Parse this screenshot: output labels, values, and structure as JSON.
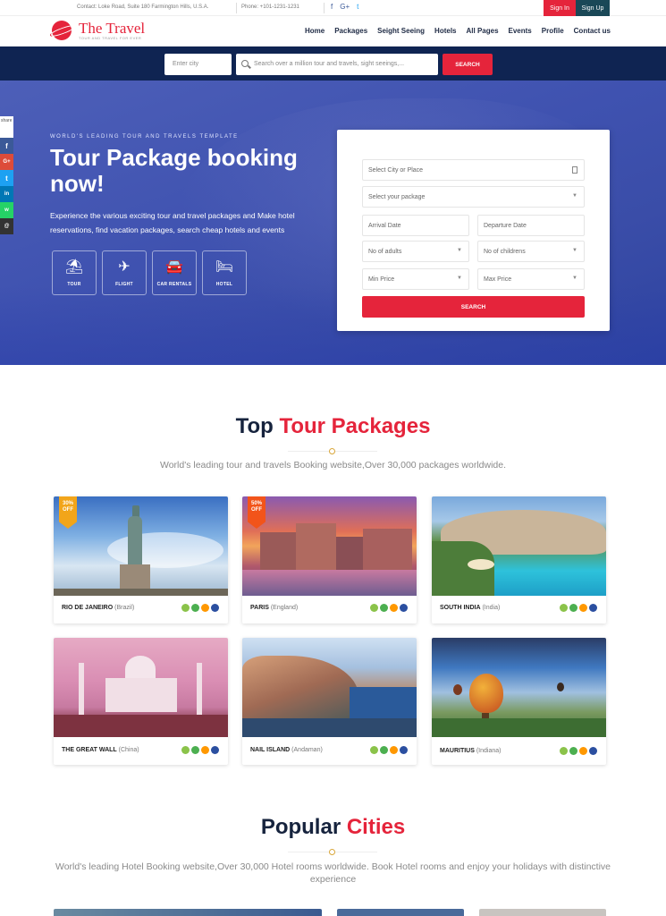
{
  "topbar": {
    "contact": "Contact: Loke Road, Suite 180 Farmington Hills, U.S.A.",
    "phone": "Phone: +101-1231-1231",
    "social": [
      "f",
      "G+",
      "t"
    ],
    "sign_in": "Sign In",
    "sign_up": "Sign Up"
  },
  "logo": {
    "title": "The Travel",
    "tagline": "TOUR AND TRAVEL FOR EVER"
  },
  "menu": [
    "Home",
    "Packages",
    "Seight Seeing",
    "Hotels",
    "All Pages",
    "Events",
    "Profile",
    "Contact us"
  ],
  "search": {
    "city_placeholder": "Enter city",
    "query_placeholder": "Search over a million tour and travels, sight seeings,...",
    "button": "SEARCH"
  },
  "share": {
    "label": "share",
    "items": [
      "f",
      "G+",
      "t",
      "in",
      "w",
      "@"
    ]
  },
  "hero": {
    "kicker": "WORLD'S LEADING TOUR AND TRAVELS TEMPLATE",
    "title": "Tour Package booking now!",
    "text": "Experience the various exciting tour and travel packages and Make hotel reservations, find vacation packages, search cheap hotels and events",
    "categories": [
      {
        "label": "TOUR",
        "icon": "umbrella-icon"
      },
      {
        "label": "FLIGHT",
        "icon": "plane-icon"
      },
      {
        "label": "CAR RENTALS",
        "icon": "car-icon"
      },
      {
        "label": "HOTEL",
        "icon": "bed-icon"
      }
    ]
  },
  "booking_form": {
    "city": "Select City or Place",
    "package": "Select your package",
    "arrival": "Arrival Date",
    "departure": "Departure Date",
    "adults": "No of adults",
    "children": "No of childrens",
    "min_price": "Min Price",
    "max_price": "Max Price",
    "button": "SEARCH"
  },
  "top_packages": {
    "title_a": "Top",
    "title_b": "Tour Packages",
    "subtitle": "World's leading tour and travels Booking website,Over 30,000 packages worldwide.",
    "cards": [
      {
        "name": "RIO DE JANEIRO",
        "country": "(Brazil)",
        "badge": "30% OFF"
      },
      {
        "name": "PARIS",
        "country": "(England)",
        "badge": "50% OFF"
      },
      {
        "name": "SOUTH INDIA",
        "country": "(India)",
        "badge": ""
      },
      {
        "name": "THE GREAT WALL",
        "country": "(China)",
        "badge": ""
      },
      {
        "name": "NAIL ISLAND",
        "country": "(Andaman)",
        "badge": ""
      },
      {
        "name": "MAURITIUS",
        "country": "(Indiana)",
        "badge": ""
      }
    ]
  },
  "popular_cities": {
    "title_a": "Popular",
    "title_b": "Cities",
    "subtitle": "World's leading Hotel Booking website,Over 30,000 Hotel rooms worldwide. Book Hotel rooms and enjoy your holidays with distinctive experience"
  },
  "colors": {
    "accent": "#e5243b",
    "navy": "#0f2452",
    "dark_teal": "#1a4857"
  }
}
